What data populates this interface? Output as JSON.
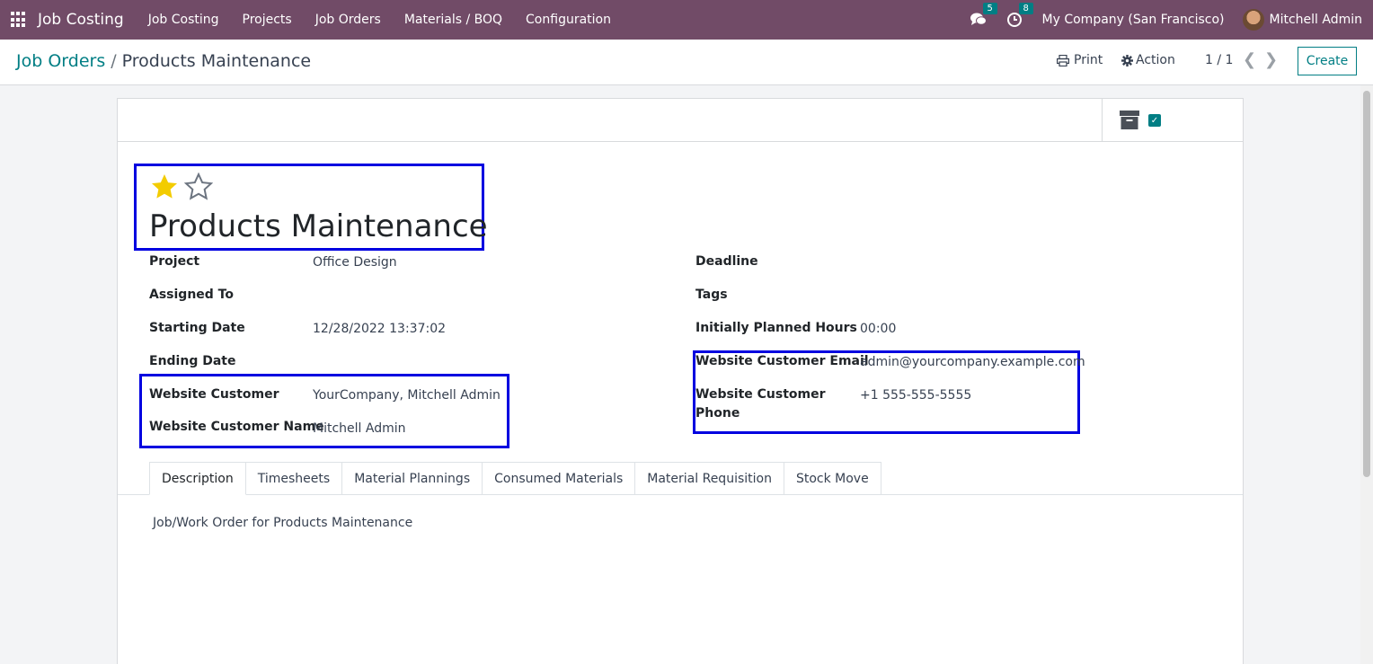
{
  "app": {
    "name": "Job Costing"
  },
  "nav": {
    "menu": [
      "Job Costing",
      "Projects",
      "Job Orders",
      "Materials / BOQ",
      "Configuration"
    ],
    "messages_count": "5",
    "activities_count": "8",
    "company": "My Company (San Francisco)",
    "user": "Mitchell Admin"
  },
  "breadcrumb": {
    "parent": "Job Orders",
    "separator": "/",
    "current": "Products Maintenance"
  },
  "control": {
    "print_label": "Print",
    "action_label": "Action",
    "pager": "1 / 1",
    "create_label": "Create"
  },
  "record": {
    "title": "Products Maintenance",
    "priority_filled": 1,
    "priority_total": 2,
    "left_fields": [
      {
        "label": "Project",
        "value": "Office Design"
      },
      {
        "label": "Assigned To",
        "value": ""
      },
      {
        "label": "Starting Date",
        "value": "12/28/2022 13:37:02"
      },
      {
        "label": "Ending Date",
        "value": ""
      },
      {
        "label": "Website Customer",
        "value": "YourCompany, Mitchell Admin"
      },
      {
        "label": "Website Customer Name",
        "value": "Mitchell Admin"
      }
    ],
    "right_fields": [
      {
        "label": "Deadline",
        "value": ""
      },
      {
        "label": "Tags",
        "value": ""
      },
      {
        "label": "Initially Planned Hours",
        "value": "00:00"
      },
      {
        "label": "Website Customer Email",
        "value": "admin@yourcompany.example.com"
      },
      {
        "label_line1": "Website Customer",
        "label_line2": "Phone",
        "value": "+1 555-555-5555"
      }
    ]
  },
  "tabs": [
    "Description",
    "Timesheets",
    "Material Plannings",
    "Consumed Materials",
    "Material Requisition",
    "Stock Move"
  ],
  "active_tab": "Description",
  "description": "Job/Work Order for Products Maintenance",
  "colors": {
    "navbar": "#714b67",
    "accent": "#017e84",
    "highlight": "#0000e0",
    "star": "#f3cc00"
  }
}
